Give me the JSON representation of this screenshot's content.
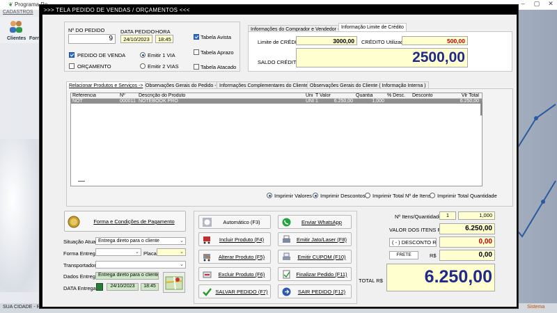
{
  "background": {
    "app_title": "Programa Re",
    "menu_label": "CADASTROS",
    "toolbar": [
      "Clientes",
      "Forne"
    ],
    "status_city": "SUA CIDADE - RS",
    "status_right": "Sistema"
  },
  "dialog": {
    "title": ">>>   TELA PEDIDO DE VENDAS / ORÇAMENTOS   <<<"
  },
  "order": {
    "number_label": "Nº DO PEDIDO",
    "number_value": "9",
    "date_label": "DATA PEDIDO",
    "date_value": "24/10/2023",
    "time_label": "HORA",
    "time_value": "18:45",
    "pedido_label": "PEDIDO DE VENDA",
    "orcamento_label": "ORÇAMENTO",
    "emitir1_label": "Emitir 1 VIA",
    "emitir2_label": "Emitir 2 VIAS",
    "tabela_avista": "Tabela Avista",
    "tabela_aprazo": "Tabela Aprazo",
    "tabela_atacado": "Tabela Atacado"
  },
  "credit": {
    "tab1": "Informações do Comprador e Vendedor ->",
    "tab2": "Informação Limite de Crédito",
    "limit_label": "Limite de CRÉDITO",
    "limit_value": "3000,00",
    "used_label": "CRÉDITO Utilizado",
    "used_value": "500,00",
    "balance_label": "SALDO CRÉDITO",
    "balance_value": "2500,00"
  },
  "tabs": [
    "Relacionar Produtos e Serviços ->",
    "Observações Gerais do Pedido ->",
    "Informações Complementares do Cliente ->",
    "Observações Gerais do Cliente ( Informação Interna )"
  ],
  "grid": {
    "columns": [
      "Referencia",
      "Nº",
      "Descrição do Produto",
      "Uni",
      "T",
      "Valor",
      "Quantia",
      "% Desc.",
      "Desconto",
      "Vlr Total"
    ],
    "rows": [
      [
        "NOT",
        "000011",
        "NOTEBOOK PRO",
        "UNI",
        "1",
        "6.250,00",
        "1,000",
        "",
        "",
        "6.250,00"
      ]
    ]
  },
  "print_options": {
    "valores": "Imprimir Valores",
    "descontos": "Imprimir Descontos",
    "total_itens": "Imprimir Total Nº de Itens",
    "total_qtd": "Imprimir Total Quantidade"
  },
  "payment": {
    "button_label": "Forma e Condições de Pagamento",
    "situacao_label": "Situação Atual",
    "situacao_value": "Entrega direto para o cliente",
    "forma_entrega_label": "Forma Entrega",
    "forma_entrega_value": "",
    "placa_label": "Placa",
    "placa_value": "",
    "transportador_label": "Transportador",
    "transportador_value": "",
    "dados_entrega_label": "Dados Entrega",
    "dados_entrega_value": "Entrega direto para o cliente",
    "data_entrega_label": "DATA Entrega",
    "data_entrega_value": "24/10/2023",
    "hora_entrega_value": "18:45"
  },
  "actions": {
    "automatico": "Automático      (F3)",
    "incluir": "Incluir Produto  (F4)",
    "alterar": "Alterar Produto  (F5)",
    "excluir": "Excluir Produto  (F6)",
    "salvar": "SALVAR PEDIDO (F7)",
    "whatsapp": "Enviar WhatsApp",
    "jato": "Emitir Jato/Laser (F8)",
    "cupom": "Emitir CUPOM    (F10)",
    "finalizar": "Finalizar Pedido  (F11)",
    "sair": "SAIR  PEDIDO  (F12)"
  },
  "totals": {
    "itens_label": "Nº Itens/Quantidade",
    "itens_value": "1",
    "quantidade_value": "1,000",
    "valor_itens_label": "VALOR DOS ITENS R$",
    "valor_itens_value": "6.250,00",
    "desconto_label": "( - ) DESCONTO R$",
    "desconto_value": "0,00",
    "frete_label": "FRETE",
    "frete_currency": "R$",
    "frete_value": "0,00",
    "total_label": "TOTAL R$",
    "total_value": "6.250,00"
  },
  "colors": {
    "accent": "#1f2a8a",
    "negative": "#c00000",
    "highlight_field": "#ffffd0",
    "selected_row": "#8f8f8f",
    "dialog_titlebar": "#000000"
  }
}
